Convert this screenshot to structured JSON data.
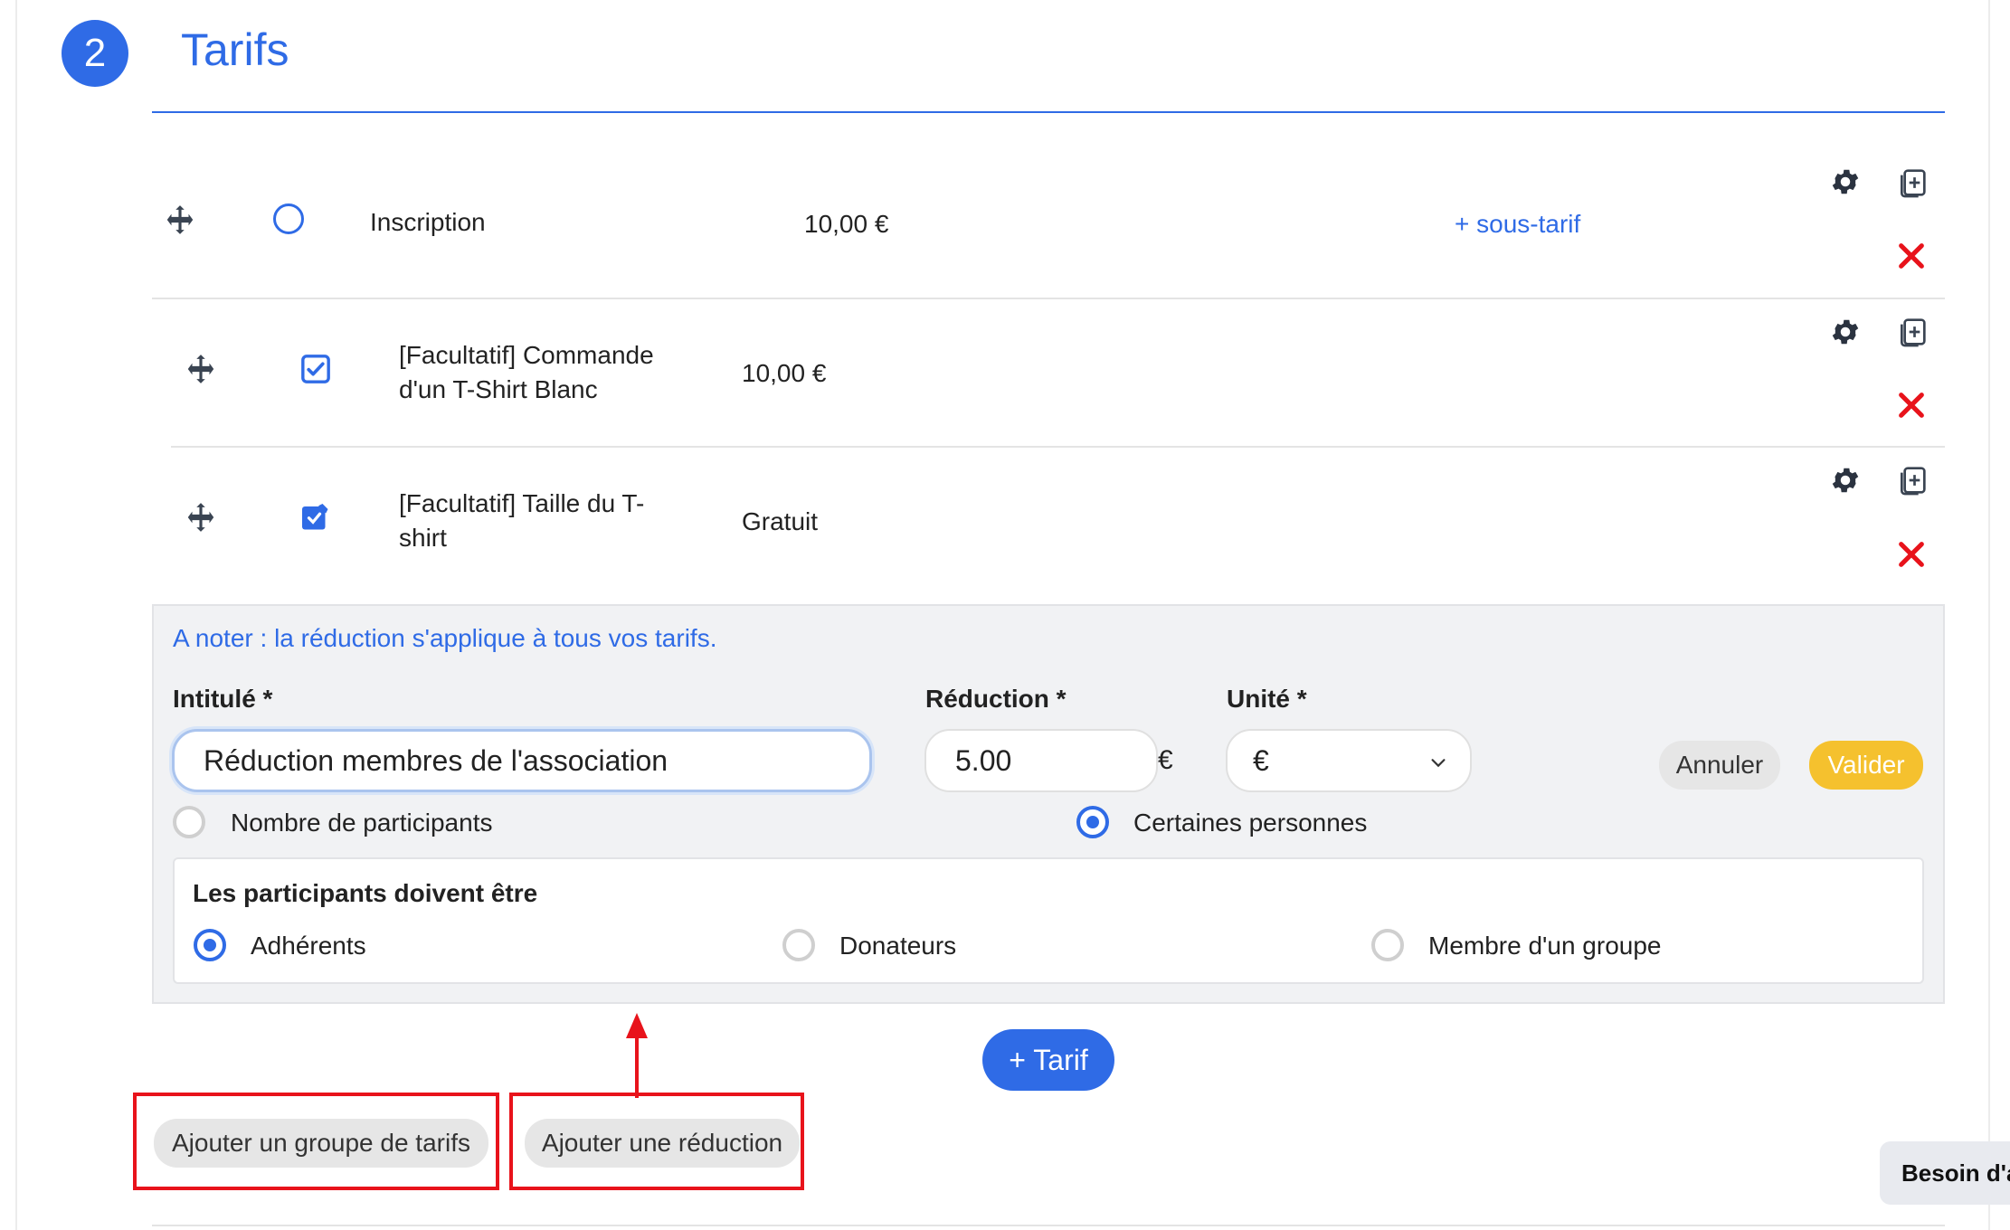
{
  "section": {
    "step": "2",
    "title": "Tarifs"
  },
  "tarifs": [
    {
      "label": "Inscription",
      "price": "10,00 €",
      "sublink": "+ sous-tarif"
    },
    {
      "label_line1": "[Facultatif] Commande",
      "label_line2": "d'un T-Shirt Blanc",
      "price": "10,00 €"
    },
    {
      "label_line1": "[Facultatif] Taille du T-",
      "label_line2": "shirt",
      "price": "Gratuit"
    }
  ],
  "reduction_form": {
    "note": "A noter : la réduction s'applique à tous vos tarifs.",
    "intitule_label": "Intitulé *",
    "intitule_value": "Réduction membres de l'association",
    "reduction_label": "Réduction *",
    "reduction_value": "5.00",
    "reduction_suffix": "€",
    "unite_label": "Unité *",
    "unite_value": "€",
    "cancel_label": "Annuler",
    "validate_label": "Valider",
    "mode_options": [
      {
        "label": "Nombre de participants",
        "selected": false
      },
      {
        "label": "Certaines personnes",
        "selected": true
      }
    ],
    "participants_title": "Les participants doivent être",
    "participant_options": [
      {
        "label": "Adhérents",
        "selected": true
      },
      {
        "label": "Donateurs",
        "selected": false
      },
      {
        "label": "Membre d'un groupe",
        "selected": false
      }
    ]
  },
  "actions": {
    "add_tarif": "+ Tarif",
    "add_group": "Ajouter un groupe de tarifs",
    "add_reduction": "Ajouter une réduction"
  },
  "help_widget": {
    "label": "Besoin d'aide"
  },
  "colors": {
    "primary": "#2f6be6",
    "accent_yellow": "#f5c12e",
    "danger": "#e8131b",
    "panel_bg": "#f1f2f4"
  },
  "icons": {
    "move": "move-arrows-icon",
    "gear": "gear-icon",
    "duplicate": "duplicate-icon",
    "delete": "close-x-icon",
    "radio_empty": "radio-empty-icon",
    "checkbox": "checkbox-checked-icon",
    "edit_checkbox": "edit-checkbox-icon",
    "chevron": "chevron-down-icon"
  }
}
